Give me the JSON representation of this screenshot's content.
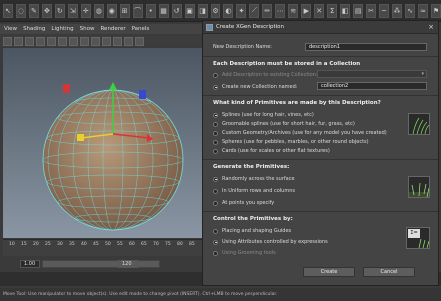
{
  "shelf": {
    "icons": [
      "select-icon",
      "lasso-icon",
      "paint-icon",
      "move-icon",
      "rotate-icon",
      "scale-icon",
      "universal-icon",
      "soft-icon",
      "show-icon",
      "snap-grid-icon",
      "snap-curve-icon",
      "snap-point-icon",
      "snap-plane-icon",
      "history-icon",
      "render-icon",
      "ipr-icon",
      "settings-icon",
      "hypershade-icon",
      "xgen-icon",
      "guide-icon",
      "brush-icon",
      "comb-icon",
      "groom-icon",
      "preview-icon",
      "clear-icon",
      "expr-icon",
      "mask-icon",
      "density-icon",
      "cut-icon",
      "noise-icon",
      "clump-icon",
      "coil-icon",
      "wind-icon",
      "pref-icon"
    ]
  },
  "viewport_menu": [
    "View",
    "Shading",
    "Lighting",
    "Show",
    "Renderer",
    "Panels"
  ],
  "timeline": {
    "ticks": [
      "10",
      "15",
      "20",
      "25",
      "30",
      "35",
      "40",
      "45",
      "50",
      "55",
      "60",
      "65",
      "70",
      "75",
      "80",
      "85",
      "90"
    ]
  },
  "range": {
    "start": "1.00",
    "end": "120"
  },
  "helpline": "Move Tool: Use manipulator to move object(s). Use edit mode to change pivot (INSERT). Ctrl+LMB to move perpendicular.",
  "dialog": {
    "title": "Create XGen Description",
    "new_description_label": "New Description Name:",
    "new_description_value": "description1",
    "collection_header": "Each Description must be stored in a Collection",
    "add_to_existing_label": "Add Description to existing Collection:",
    "create_new_label": "Create new Collection named:",
    "collection_value": "collection2",
    "primitives_header": "What kind of Primitives are made by this Description?",
    "primitives": [
      {
        "label": "Splines (use for long hair, vines, etc)",
        "selected": true
      },
      {
        "label": "Groomable splines (use for short hair, fur, grass, etc)",
        "selected": false
      },
      {
        "label": "Custom Geometry/Archives (use for any model you have created)",
        "selected": false
      },
      {
        "label": "Spheres (use for pebbles, marbles, or other round objects)",
        "selected": false
      },
      {
        "label": "Cards (use for scales or other flat textures)",
        "selected": false
      }
    ],
    "generate_header": "Generate the Primitives:",
    "generate": [
      {
        "label": "Randomly across the surface",
        "selected": true
      },
      {
        "label": "In Uniform rows and columns",
        "selected": false
      },
      {
        "label": "At points you specify",
        "selected": false
      }
    ],
    "control_header": "Control the Primitives by:",
    "control": [
      {
        "label": "Placing and shaping Guides",
        "selected": false
      },
      {
        "label": "Using Attributes controlled by expressions",
        "selected": true
      },
      {
        "label": "Using Grooming tools",
        "selected": false,
        "disabled": true
      }
    ],
    "create_button": "Create",
    "cancel_button": "Cancel",
    "expr_symbol": "Σ="
  }
}
